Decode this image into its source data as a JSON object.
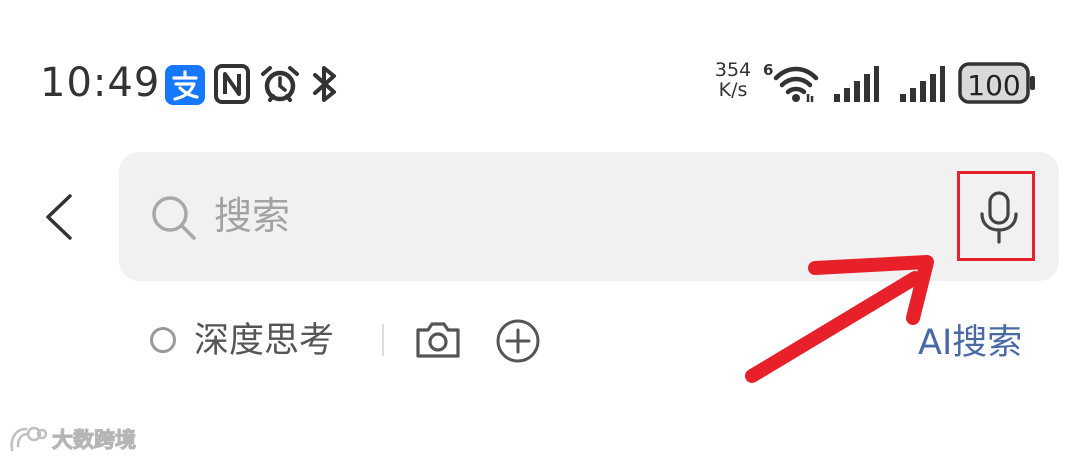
{
  "status_bar": {
    "time": "10:49",
    "net_speed_value": "354",
    "net_speed_unit": "K/s",
    "wifi_badge": "6",
    "battery": "100",
    "icons": [
      "alipay-icon",
      "nfc-icon",
      "alarm-icon",
      "bluetooth-icon",
      "wifi-icon",
      "signal-icon",
      "signal-icon",
      "battery-icon"
    ]
  },
  "search": {
    "placeholder": "搜索",
    "back_icon": "back-chevron-icon",
    "search_icon": "magnifier-icon",
    "mic_icon": "microphone-icon"
  },
  "toolbar": {
    "deep_think_label": "深度思考",
    "camera_icon": "camera-icon",
    "plus_icon": "plus-circle-icon",
    "ai_search_label": "AI搜索"
  },
  "colors": {
    "accent_link": "#4a6aa6",
    "annotation_red": "#e8202a",
    "search_bg": "#f1f1f1",
    "alipay_blue": "#1677ff"
  },
  "watermark": {
    "text": "大数跨境"
  }
}
